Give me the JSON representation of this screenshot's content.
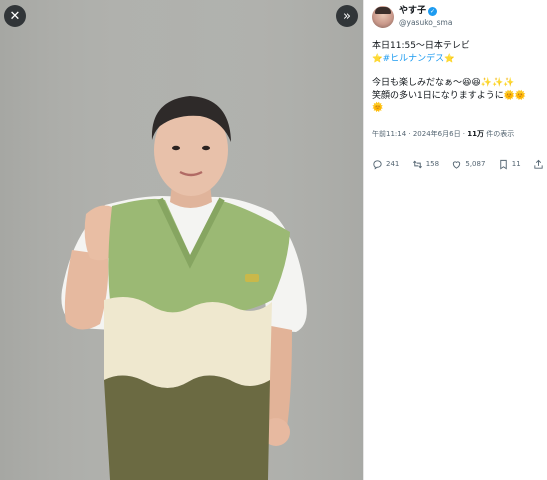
{
  "viewer": {
    "close_glyph": "✕",
    "next_glyph": "»"
  },
  "author": {
    "display_name": "やす子",
    "verified_glyph": "✓",
    "handle": "@yasuko_sma"
  },
  "tweet": {
    "line1": "本日11:55〜日本テレビ",
    "line2_prefix": "⭐",
    "hashtag": "#ヒルナンデス",
    "line2_suffix": "⭐",
    "line3": "今日も楽しみだなぁ〜😆😆✨✨✨",
    "line4": "笑顔の多い1日になりますように🌞🌞",
    "line5": "🌞"
  },
  "meta": {
    "time_date": "午前11:14 · 2024年6月6日 · ",
    "views_count": "11万",
    "views_suffix": " 件の表示"
  },
  "actions": {
    "replies": "241",
    "retweets": "158",
    "likes": "5,087",
    "bookmarks": "11"
  },
  "icons": {
    "reply": "reply-icon",
    "retweet": "retweet-icon",
    "like": "heart-icon",
    "bookmark": "bookmark-icon",
    "share": "share-icon"
  },
  "colors": {
    "accent": "#1d9bf0",
    "secondary_text": "#536471",
    "vest_green": "#9bb974",
    "vest_cream": "#efe8cf",
    "vest_olive": "#6b6a42"
  }
}
